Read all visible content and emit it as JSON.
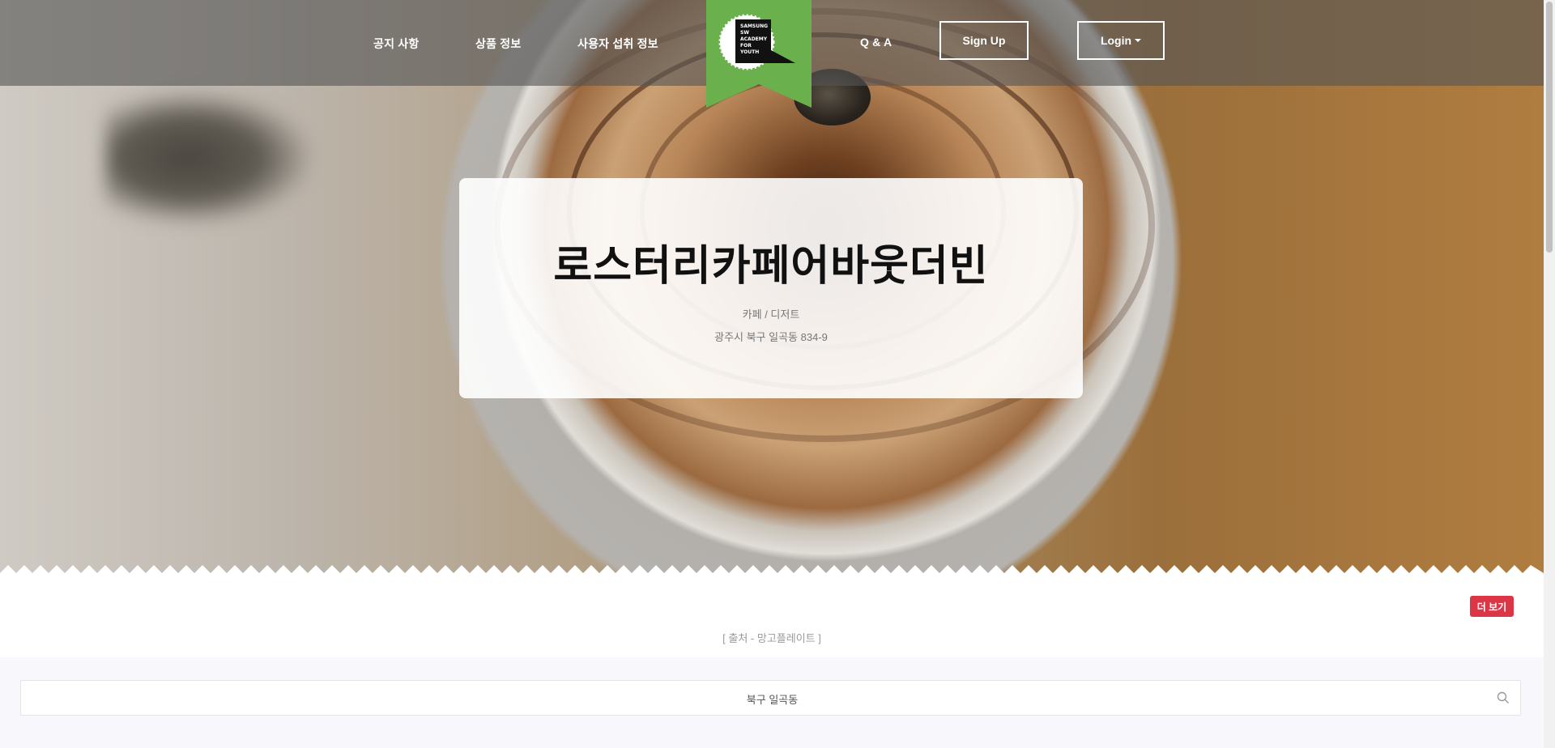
{
  "nav": {
    "left_links": [
      "공지 사항",
      "상품 정보",
      "사용자 섭취 정보"
    ],
    "right_link": "Q & A",
    "signup_label": "Sign Up",
    "login_label": "Login",
    "logo_text": [
      "SAMSUNG",
      "SW",
      "ACADEMY",
      "FOR",
      "YOUTH"
    ],
    "logo_color": "#6ab04c"
  },
  "card": {
    "title": "로스터리카페어바웃더빈",
    "category": "카페 / 디저트",
    "address": "광주시 북구 일곡동 834-9"
  },
  "more_button_label": "더 보기",
  "more_button_color": "#dc3545",
  "source_text": "[ 출처 - 망고플레이트 ]",
  "search": {
    "value": "북구 일곡동",
    "icon": "search-icon"
  }
}
